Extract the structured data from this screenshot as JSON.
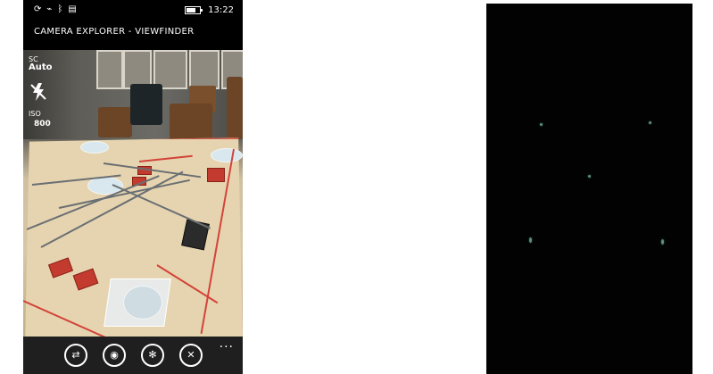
{
  "status_bar": {
    "time": "13:22",
    "battery_level": 0.7,
    "icons": [
      "sync-icon",
      "signal-off-icon",
      "bluetooth-icon",
      "message-icon"
    ]
  },
  "app": {
    "title": "CAMERA EXPLORER - VIEWFINDER"
  },
  "overlay": {
    "scene_label": "SC",
    "scene_value": "Auto",
    "flash_icon": "flash-off-icon",
    "iso_label": "ISO",
    "iso_value": "800"
  },
  "app_bar": {
    "buttons": [
      {
        "name": "switch-camera-button",
        "icon": "camera-switch-icon",
        "glyph": "⇄"
      },
      {
        "name": "capture-button",
        "icon": "camera-icon",
        "glyph": "◉"
      },
      {
        "name": "settings-button",
        "icon": "gear-icon",
        "glyph": "✻"
      },
      {
        "name": "close-button",
        "icon": "close-icon",
        "glyph": "✕"
      }
    ],
    "more": "..."
  }
}
